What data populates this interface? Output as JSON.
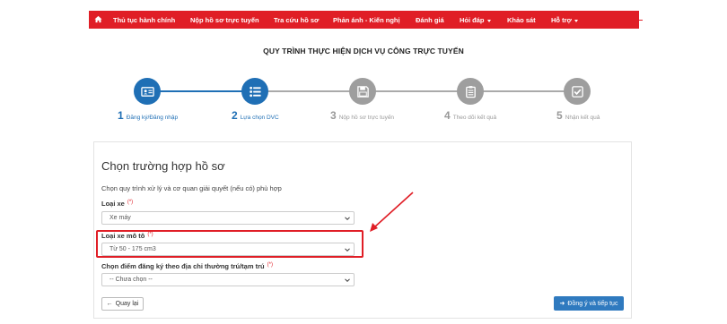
{
  "nav": {
    "items": [
      "Thủ tục hành chính",
      "Nộp hồ sơ trực tuyến",
      "Tra cứu hồ sơ",
      "Phản ánh - Kiến nghị",
      "Đánh giá",
      "Hỏi đáp",
      "Khảo sát",
      "Hỗ trợ"
    ]
  },
  "page": {
    "title": "QUY TRÌNH THỰC HIỆN DỊCH VỤ CÔNG TRỰC TUYẾN"
  },
  "steps": [
    {
      "num": "1",
      "label": "Đăng ký/Đăng nhập",
      "state": "active",
      "icon": "id-card-icon"
    },
    {
      "num": "2",
      "label": "Lựa chọn DVC",
      "state": "active",
      "icon": "list-icon"
    },
    {
      "num": "3",
      "label": "Nộp hồ sơ trực tuyến",
      "state": "inactive",
      "icon": "save-icon"
    },
    {
      "num": "4",
      "label": "Theo dõi kết quả",
      "state": "inactive",
      "icon": "clipboard-icon"
    },
    {
      "num": "5",
      "label": "Nhận kết quả",
      "state": "inactive",
      "icon": "check-square-icon"
    }
  ],
  "form": {
    "title": "Chọn trường hợp hồ sơ",
    "subtitle": "Chọn quy trình xử lý và cơ quan giải quyết (nếu có) phù hợp",
    "required_mark": "(*)",
    "fields": [
      {
        "label": "Loại xe",
        "value": "Xe máy"
      },
      {
        "label": "Loại xe mô tô",
        "value": "Từ 50 - 175 cm3"
      },
      {
        "label": "Chọn điểm đăng ký theo địa chỉ thường trú/tạm trú",
        "value": "-- Chưa chọn --"
      }
    ],
    "back_label": "Quay lại",
    "next_label": "Đồng ý và tiếp tục"
  },
  "colors": {
    "nav": "#e01e26",
    "active": "#1f6fb5",
    "inactive": "#9e9e9e",
    "annotation": "#e01e26"
  }
}
